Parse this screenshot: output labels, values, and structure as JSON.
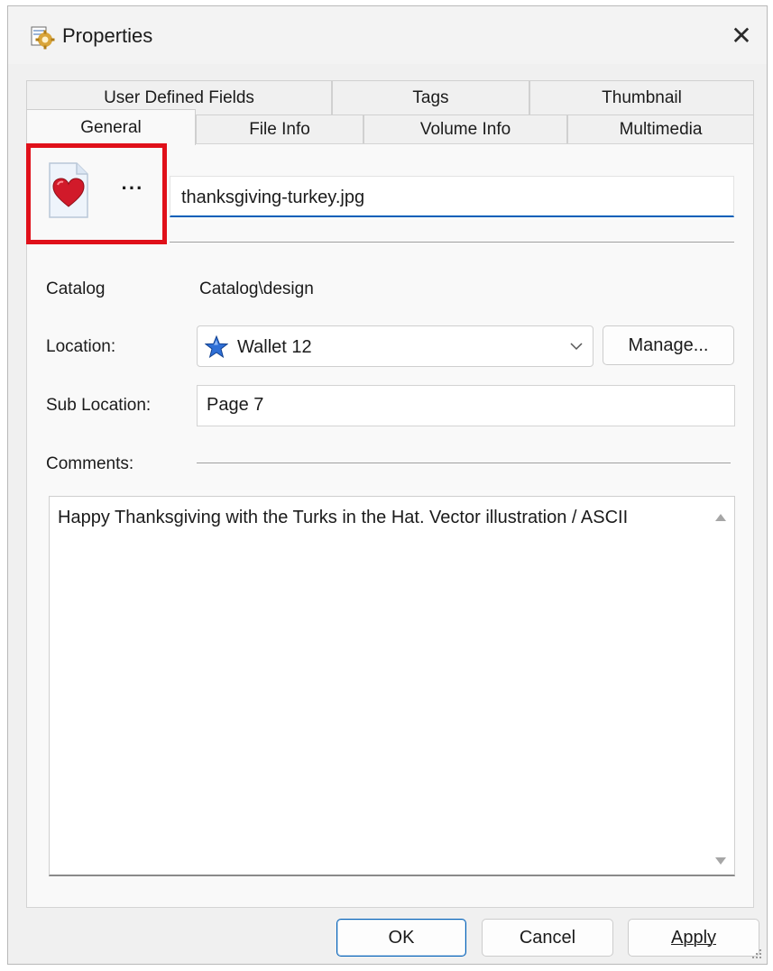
{
  "window": {
    "title": "Properties",
    "close_glyph": "✕",
    "title_icon": "properties-gear-icon"
  },
  "tabs": {
    "row1": [
      {
        "label": "User Defined Fields"
      },
      {
        "label": "Tags"
      },
      {
        "label": "Thumbnail"
      }
    ],
    "row2": [
      {
        "label": "General",
        "active": true
      },
      {
        "label": "File Info"
      },
      {
        "label": "Volume Info"
      },
      {
        "label": "Multimedia"
      }
    ]
  },
  "general": {
    "file_icon": "heart-file-icon",
    "ellipsis_label": "···",
    "file_name": "thanksgiving-turkey.jpg",
    "catalog_label": "Catalog",
    "catalog_value": "Catalog\\design",
    "location_label": "Location:",
    "location_value": "Wallet 12",
    "location_icon": "blue-star-icon",
    "manage_label": "Manage...",
    "sublocation_label": "Sub Location:",
    "sublocation_value": "Page 7",
    "comments_label": "Comments:",
    "comments_text": "Happy Thanksgiving with the Turks in the Hat. Vector illustration / ASCII"
  },
  "buttons": {
    "ok": "OK",
    "cancel": "Cancel",
    "apply": "Apply"
  },
  "colors": {
    "highlight": "#e0101a",
    "accent": "#005fb8",
    "star": "#2f6fd6",
    "heart": "#d11a2a"
  }
}
